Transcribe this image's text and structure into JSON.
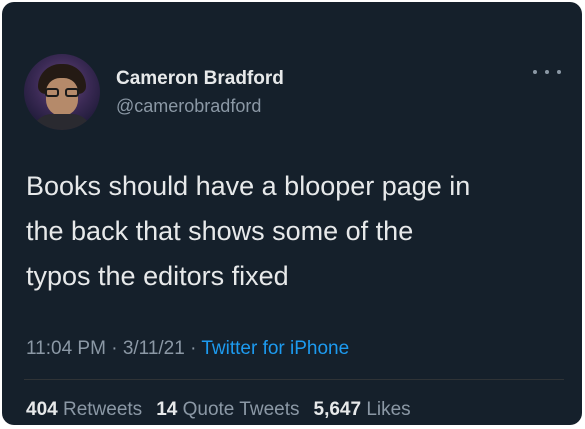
{
  "tweet": {
    "author": {
      "display_name": "Cameron Bradford",
      "handle": "@camerobradford"
    },
    "text_lines": [
      "Books should have a blooper page in",
      "the back that shows some of the",
      "typos the editors fixed"
    ],
    "time": "11:04 PM",
    "date": "3/11/21",
    "separator": "·",
    "source": "Twitter for iPhone",
    "stats": {
      "retweets_count": "404",
      "retweets_label": "Retweets",
      "quote_count": "14",
      "quote_label": "Quote Tweets",
      "likes_count": "5,647",
      "likes_label": "Likes"
    }
  },
  "icons": {
    "more": "more-horizontal-icon"
  },
  "colors": {
    "background": "#15202b",
    "primary_text": "#e7e9ea",
    "secondary_text": "#8b98a5",
    "link": "#1d9bf0"
  }
}
